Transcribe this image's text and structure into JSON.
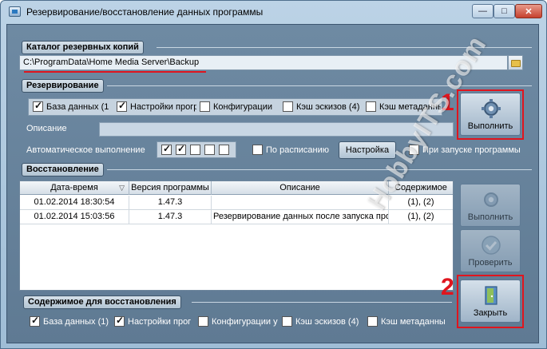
{
  "window": {
    "title": "Резервирование/восстановление данных программы",
    "controls": {
      "minimize": "—",
      "maximize": "□",
      "close": "✕"
    }
  },
  "catalog": {
    "title": "Каталог резервных копий",
    "path": "C:\\ProgramData\\Home Media Server\\Backup"
  },
  "backup": {
    "title": "Резервирование",
    "options": [
      {
        "label": "База данных (1",
        "checked": true
      },
      {
        "label": "Настройки прогр",
        "checked": true
      },
      {
        "label": "Конфигурации ",
        "checked": false
      },
      {
        "label": "Кэш эскизов (4)",
        "checked": false
      },
      {
        "label": "Кэш метаданны",
        "checked": false
      }
    ],
    "description_label": "Описание",
    "description_value": "",
    "auto_label": "Автоматическое выполнение",
    "auto_days": [
      true,
      true,
      false,
      false,
      false
    ],
    "schedule_label": "По расписанию",
    "schedule_checked": false,
    "settings_button": "Настройка",
    "on_start_label": "При запуске программы",
    "on_start_checked": false,
    "execute_button": "Выполнить",
    "marker": "1"
  },
  "restore": {
    "title": "Восстановление",
    "columns": [
      "Дата-время",
      "Версия программы",
      "Описание",
      "Содержимое"
    ],
    "rows": [
      {
        "datetime": "01.02.2014 18:30:54",
        "version": "1.47.3",
        "description": "",
        "content": "(1), (2)"
      },
      {
        "datetime": "01.02.2014 15:03:56",
        "version": "1.47.3",
        "description": "Резервирование данных после запуска про",
        "content": "(1), (2)"
      }
    ],
    "execute_button": "Выполнить",
    "verify_button": "Проверить",
    "close_button": "Закрыть",
    "marker": "2"
  },
  "restore_content": {
    "title": "Содержимое для восстановления",
    "options": [
      {
        "label": "База данных (1)",
        "checked": true
      },
      {
        "label": "Настройки прог",
        "checked": true
      },
      {
        "label": "Конфигурации у",
        "checked": false
      },
      {
        "label": "Кэш эскизов (4)",
        "checked": false
      },
      {
        "label": "Кэш метаданны",
        "checked": false
      }
    ]
  },
  "watermark": "HobbyITS.com",
  "colors": {
    "accent_red": "#e0151e",
    "panel": "#6e8aa3"
  }
}
